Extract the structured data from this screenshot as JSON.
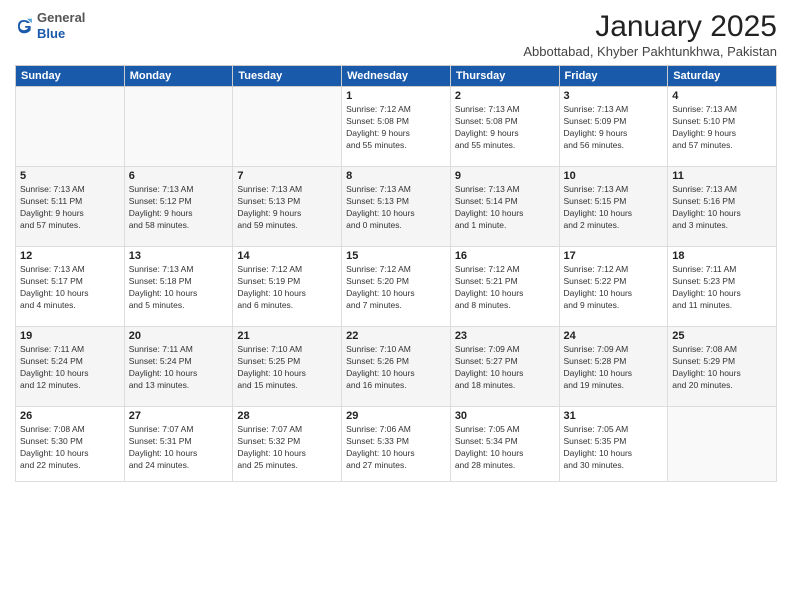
{
  "logo": {
    "general": "General",
    "blue": "Blue"
  },
  "header": {
    "title": "January 2025",
    "subtitle": "Abbottabad, Khyber Pakhtunkhwa, Pakistan"
  },
  "weekdays": [
    "Sunday",
    "Monday",
    "Tuesday",
    "Wednesday",
    "Thursday",
    "Friday",
    "Saturday"
  ],
  "weeks": [
    {
      "days": [
        {
          "num": "",
          "info": "",
          "empty": true
        },
        {
          "num": "",
          "info": "",
          "empty": true
        },
        {
          "num": "",
          "info": "",
          "empty": true
        },
        {
          "num": "1",
          "info": "Sunrise: 7:12 AM\nSunset: 5:08 PM\nDaylight: 9 hours\nand 55 minutes."
        },
        {
          "num": "2",
          "info": "Sunrise: 7:13 AM\nSunset: 5:08 PM\nDaylight: 9 hours\nand 55 minutes."
        },
        {
          "num": "3",
          "info": "Sunrise: 7:13 AM\nSunset: 5:09 PM\nDaylight: 9 hours\nand 56 minutes."
        },
        {
          "num": "4",
          "info": "Sunrise: 7:13 AM\nSunset: 5:10 PM\nDaylight: 9 hours\nand 57 minutes."
        }
      ]
    },
    {
      "days": [
        {
          "num": "5",
          "info": "Sunrise: 7:13 AM\nSunset: 5:11 PM\nDaylight: 9 hours\nand 57 minutes."
        },
        {
          "num": "6",
          "info": "Sunrise: 7:13 AM\nSunset: 5:12 PM\nDaylight: 9 hours\nand 58 minutes."
        },
        {
          "num": "7",
          "info": "Sunrise: 7:13 AM\nSunset: 5:13 PM\nDaylight: 9 hours\nand 59 minutes."
        },
        {
          "num": "8",
          "info": "Sunrise: 7:13 AM\nSunset: 5:13 PM\nDaylight: 10 hours\nand 0 minutes."
        },
        {
          "num": "9",
          "info": "Sunrise: 7:13 AM\nSunset: 5:14 PM\nDaylight: 10 hours\nand 1 minute."
        },
        {
          "num": "10",
          "info": "Sunrise: 7:13 AM\nSunset: 5:15 PM\nDaylight: 10 hours\nand 2 minutes."
        },
        {
          "num": "11",
          "info": "Sunrise: 7:13 AM\nSunset: 5:16 PM\nDaylight: 10 hours\nand 3 minutes."
        }
      ]
    },
    {
      "days": [
        {
          "num": "12",
          "info": "Sunrise: 7:13 AM\nSunset: 5:17 PM\nDaylight: 10 hours\nand 4 minutes."
        },
        {
          "num": "13",
          "info": "Sunrise: 7:13 AM\nSunset: 5:18 PM\nDaylight: 10 hours\nand 5 minutes."
        },
        {
          "num": "14",
          "info": "Sunrise: 7:12 AM\nSunset: 5:19 PM\nDaylight: 10 hours\nand 6 minutes."
        },
        {
          "num": "15",
          "info": "Sunrise: 7:12 AM\nSunset: 5:20 PM\nDaylight: 10 hours\nand 7 minutes."
        },
        {
          "num": "16",
          "info": "Sunrise: 7:12 AM\nSunset: 5:21 PM\nDaylight: 10 hours\nand 8 minutes."
        },
        {
          "num": "17",
          "info": "Sunrise: 7:12 AM\nSunset: 5:22 PM\nDaylight: 10 hours\nand 9 minutes."
        },
        {
          "num": "18",
          "info": "Sunrise: 7:11 AM\nSunset: 5:23 PM\nDaylight: 10 hours\nand 11 minutes."
        }
      ]
    },
    {
      "days": [
        {
          "num": "19",
          "info": "Sunrise: 7:11 AM\nSunset: 5:24 PM\nDaylight: 10 hours\nand 12 minutes."
        },
        {
          "num": "20",
          "info": "Sunrise: 7:11 AM\nSunset: 5:24 PM\nDaylight: 10 hours\nand 13 minutes."
        },
        {
          "num": "21",
          "info": "Sunrise: 7:10 AM\nSunset: 5:25 PM\nDaylight: 10 hours\nand 15 minutes."
        },
        {
          "num": "22",
          "info": "Sunrise: 7:10 AM\nSunset: 5:26 PM\nDaylight: 10 hours\nand 16 minutes."
        },
        {
          "num": "23",
          "info": "Sunrise: 7:09 AM\nSunset: 5:27 PM\nDaylight: 10 hours\nand 18 minutes."
        },
        {
          "num": "24",
          "info": "Sunrise: 7:09 AM\nSunset: 5:28 PM\nDaylight: 10 hours\nand 19 minutes."
        },
        {
          "num": "25",
          "info": "Sunrise: 7:08 AM\nSunset: 5:29 PM\nDaylight: 10 hours\nand 20 minutes."
        }
      ]
    },
    {
      "days": [
        {
          "num": "26",
          "info": "Sunrise: 7:08 AM\nSunset: 5:30 PM\nDaylight: 10 hours\nand 22 minutes."
        },
        {
          "num": "27",
          "info": "Sunrise: 7:07 AM\nSunset: 5:31 PM\nDaylight: 10 hours\nand 24 minutes."
        },
        {
          "num": "28",
          "info": "Sunrise: 7:07 AM\nSunset: 5:32 PM\nDaylight: 10 hours\nand 25 minutes."
        },
        {
          "num": "29",
          "info": "Sunrise: 7:06 AM\nSunset: 5:33 PM\nDaylight: 10 hours\nand 27 minutes."
        },
        {
          "num": "30",
          "info": "Sunrise: 7:05 AM\nSunset: 5:34 PM\nDaylight: 10 hours\nand 28 minutes."
        },
        {
          "num": "31",
          "info": "Sunrise: 7:05 AM\nSunset: 5:35 PM\nDaylight: 10 hours\nand 30 minutes."
        },
        {
          "num": "",
          "info": "",
          "empty": true
        }
      ]
    }
  ]
}
